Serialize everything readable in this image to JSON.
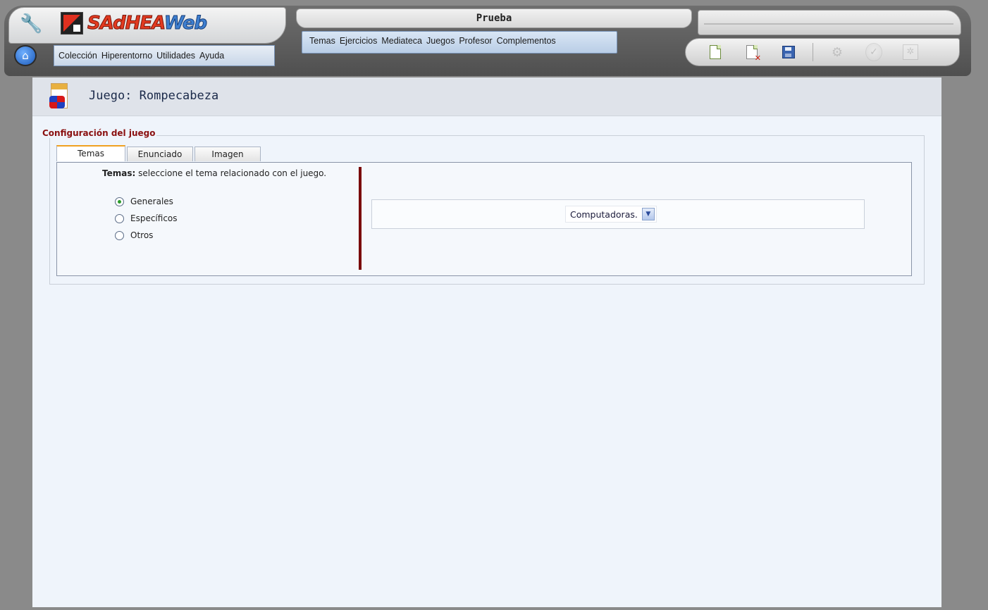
{
  "app": {
    "title": "Prueba",
    "logo_part1": "SAdHEA",
    "logo_part2": "Web"
  },
  "main_menu": {
    "items": [
      {
        "label": "Temas"
      },
      {
        "label": "Ejercicios"
      },
      {
        "label": "Mediateca"
      },
      {
        "label": "Juegos"
      },
      {
        "label": "Profesor"
      },
      {
        "label": "Complementos"
      }
    ]
  },
  "left_menu": {
    "items": [
      {
        "label": "Colección"
      },
      {
        "label": "Hiperentorno"
      },
      {
        "label": "Utilidades"
      },
      {
        "label": "Ayuda"
      }
    ]
  },
  "toolbar": {
    "icons": [
      "new-document-icon",
      "delete-document-icon",
      "save-icon",
      "settings-icon",
      "accept-icon",
      "properties-icon"
    ]
  },
  "page": {
    "title": "Juego: Rompecabeza",
    "section_legend": "Configuración del juego"
  },
  "tabs": [
    {
      "label": "Temas",
      "active": true
    },
    {
      "label": "Enunciado",
      "active": false
    },
    {
      "label": "Imagen",
      "active": false
    }
  ],
  "temas_panel": {
    "instruction_bold": "Temas:",
    "instruction_text": " seleccione el tema relacionado con el juego.",
    "options": [
      {
        "label": "Generales",
        "checked": true
      },
      {
        "label": "Específicos",
        "checked": false
      },
      {
        "label": "Otros",
        "checked": false
      }
    ],
    "select_value": "Computadoras."
  },
  "colors": {
    "accent_dark_red": "#7a0a0a",
    "legend_red": "#8a1010",
    "content_bg": "#eff4fb"
  }
}
